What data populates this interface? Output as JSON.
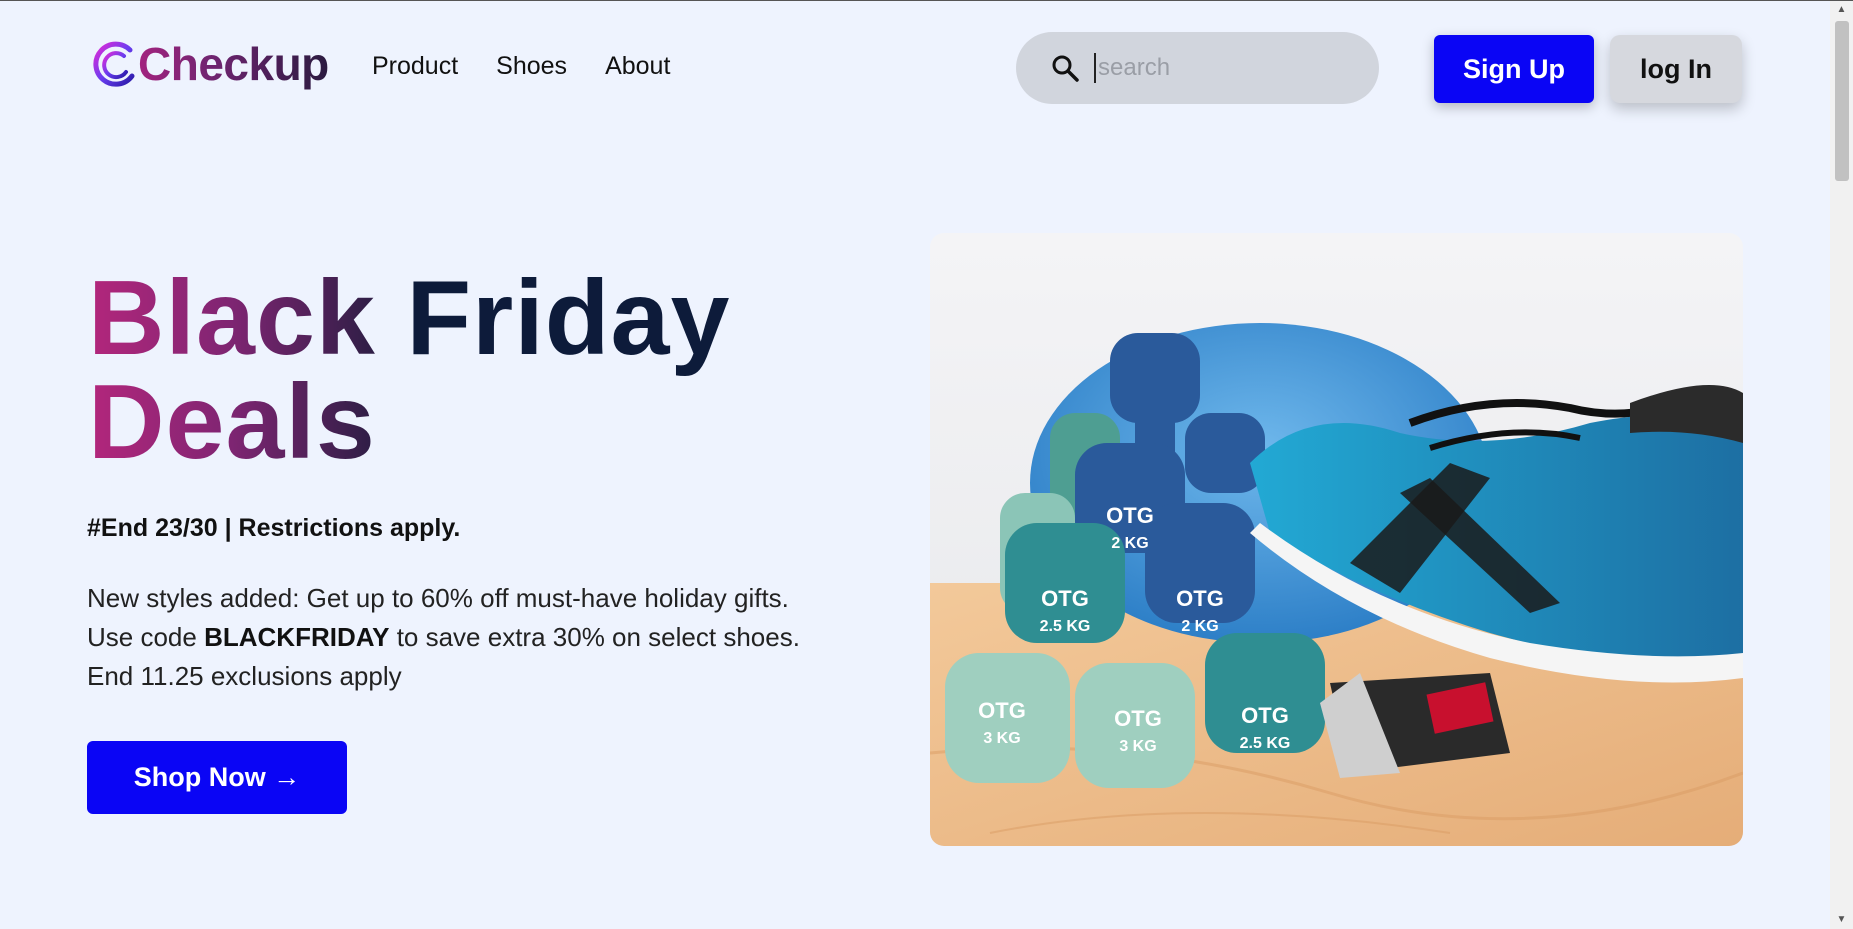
{
  "header": {
    "brand": "Checkup",
    "nav": [
      {
        "label": "Product"
      },
      {
        "label": "Shoes"
      },
      {
        "label": "About"
      }
    ],
    "search": {
      "placeholder": "search",
      "icon": "search-icon"
    },
    "signup_label": "Sign Up",
    "login_label": "log In"
  },
  "hero": {
    "headline_part1": "Black",
    "headline_part2": "Friday",
    "headline_part3": "Deals",
    "restrictions": "#End 23/30 | Restrictions apply.",
    "desc_line1": "New styles added: Get up to 60% off must-have holiday gifts.",
    "desc_line2_pre": "Use code ",
    "desc_code": "BLACKFRIDAY",
    "desc_line2_post": " to save extra 30% on select shoes.",
    "desc_line3": "End 11.25 exclusions apply",
    "cta_label": "Shop Now →"
  },
  "image": {
    "dumbbell_labels": [
      "2 KG",
      "2.5 KG",
      "2 KG",
      "3 KG",
      "3 KG",
      "2.5 KG"
    ],
    "brand_mark": "OTG"
  },
  "colors": {
    "primary_button": "#0a05f5",
    "page_background": "#eef3fe",
    "headline_dark": "#0d1b3a",
    "headline_gradient_start": "#b3267c"
  }
}
